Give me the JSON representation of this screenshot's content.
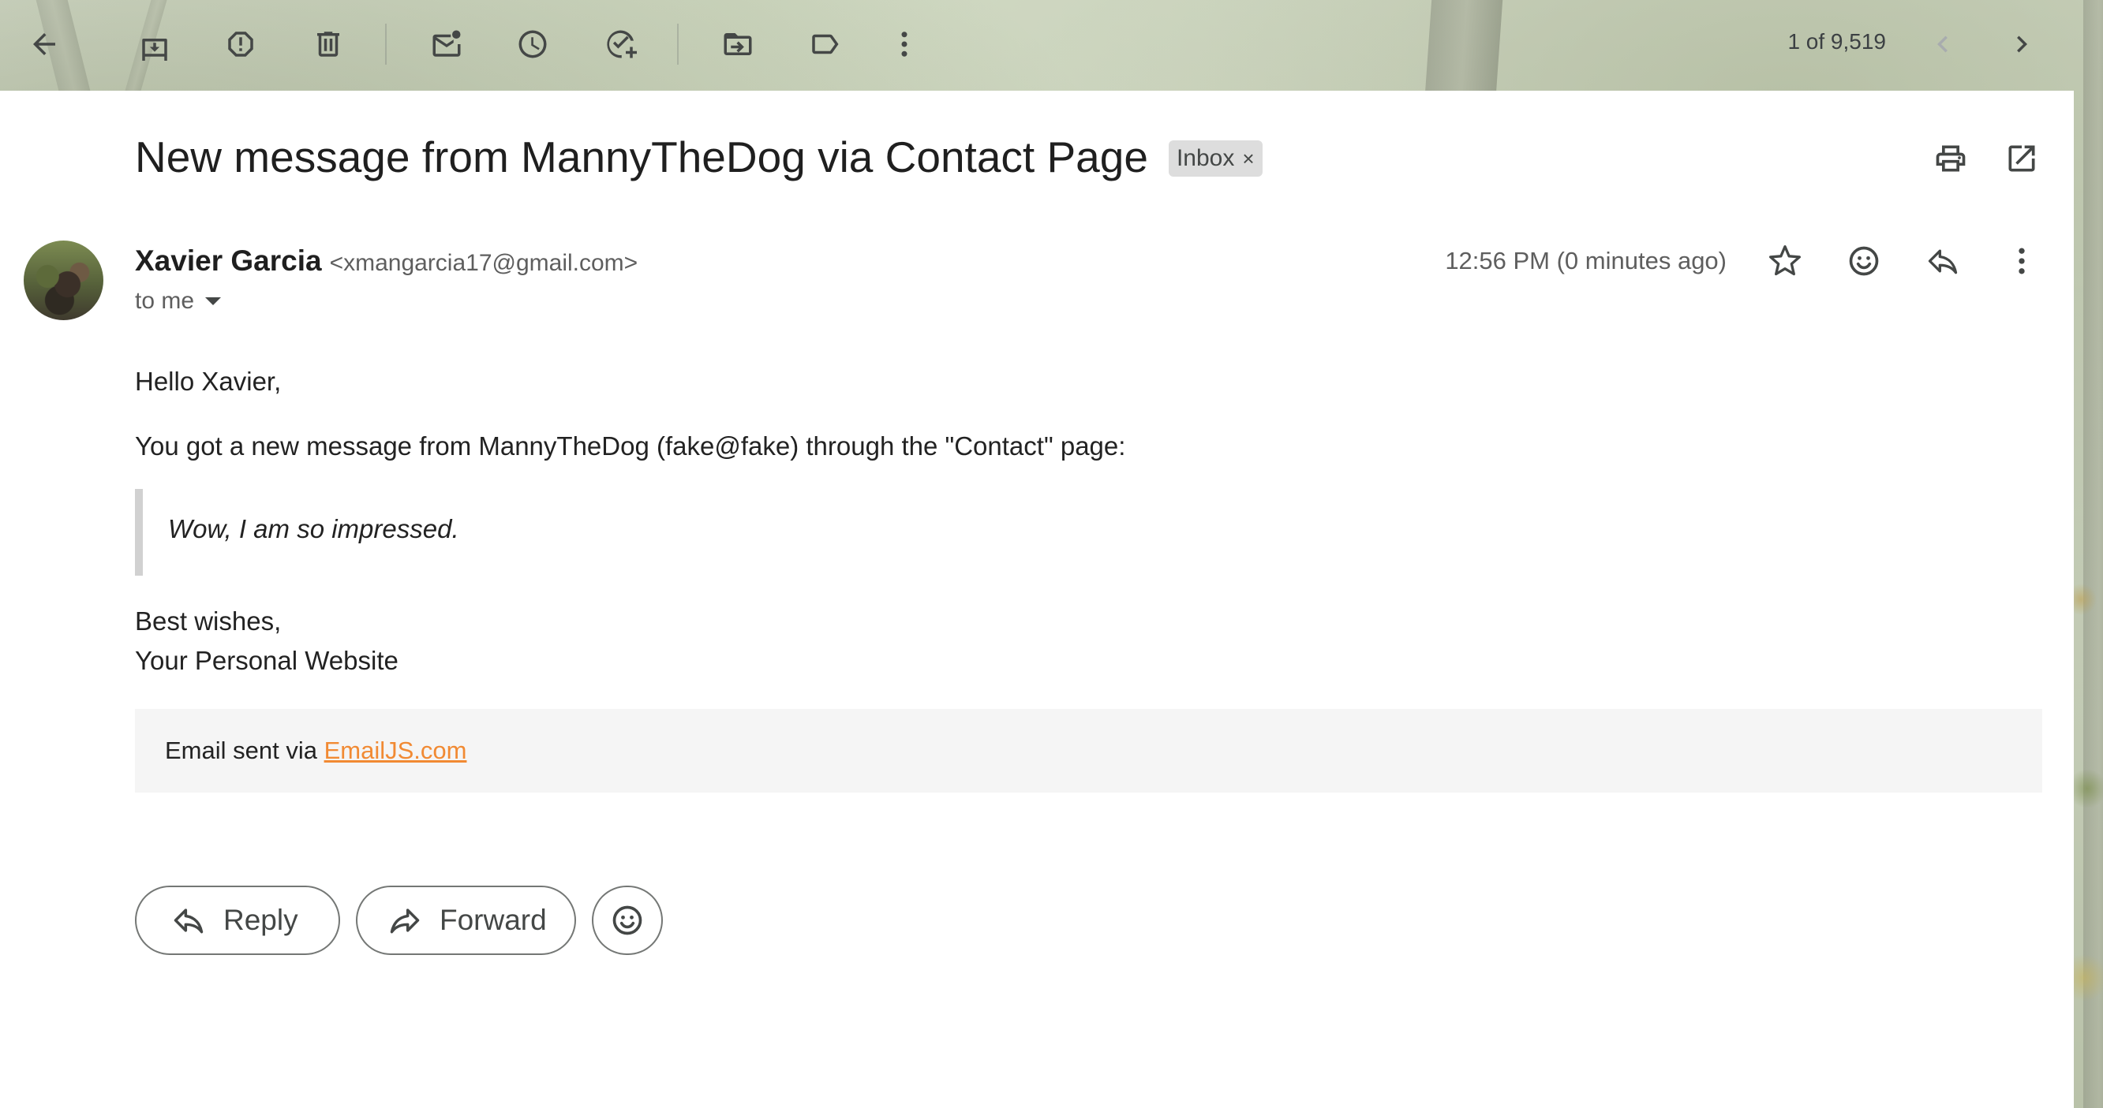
{
  "toolbar": {
    "pager_text": "1 of 9,519",
    "icons": [
      "back-arrow-icon",
      "archive-icon",
      "report-spam-icon",
      "delete-icon",
      "mark-unread-icon",
      "snooze-icon",
      "add-to-tasks-icon",
      "move-to-icon",
      "labels-icon",
      "more-vert-icon",
      "chevron-left-icon",
      "chevron-right-icon"
    ]
  },
  "email": {
    "subject": "New message from MannyTheDog via Contact Page",
    "label": "Inbox",
    "label_remove": "×",
    "sender_name": "Xavier Garcia",
    "sender_email": "<xmangarcia17@gmail.com>",
    "recipient": "to me",
    "timestamp": "12:56 PM (0 minutes ago)",
    "greeting": "Hello Xavier,",
    "intro": "You got a new message from MannyTheDog (fake@fake) through the \"Contact\" page:",
    "quote": "Wow, I am so impressed.",
    "signoff": "Best wishes,",
    "signature": "Your Personal Website",
    "footer_prefix": "Email sent via ",
    "footer_link": "EmailJS.com"
  },
  "actions": {
    "reply_label": "Reply",
    "forward_label": "Forward"
  },
  "colors": {
    "link": "#f18a33",
    "label_chip": "#dddddd",
    "footer_bg": "#f5f5f5"
  }
}
